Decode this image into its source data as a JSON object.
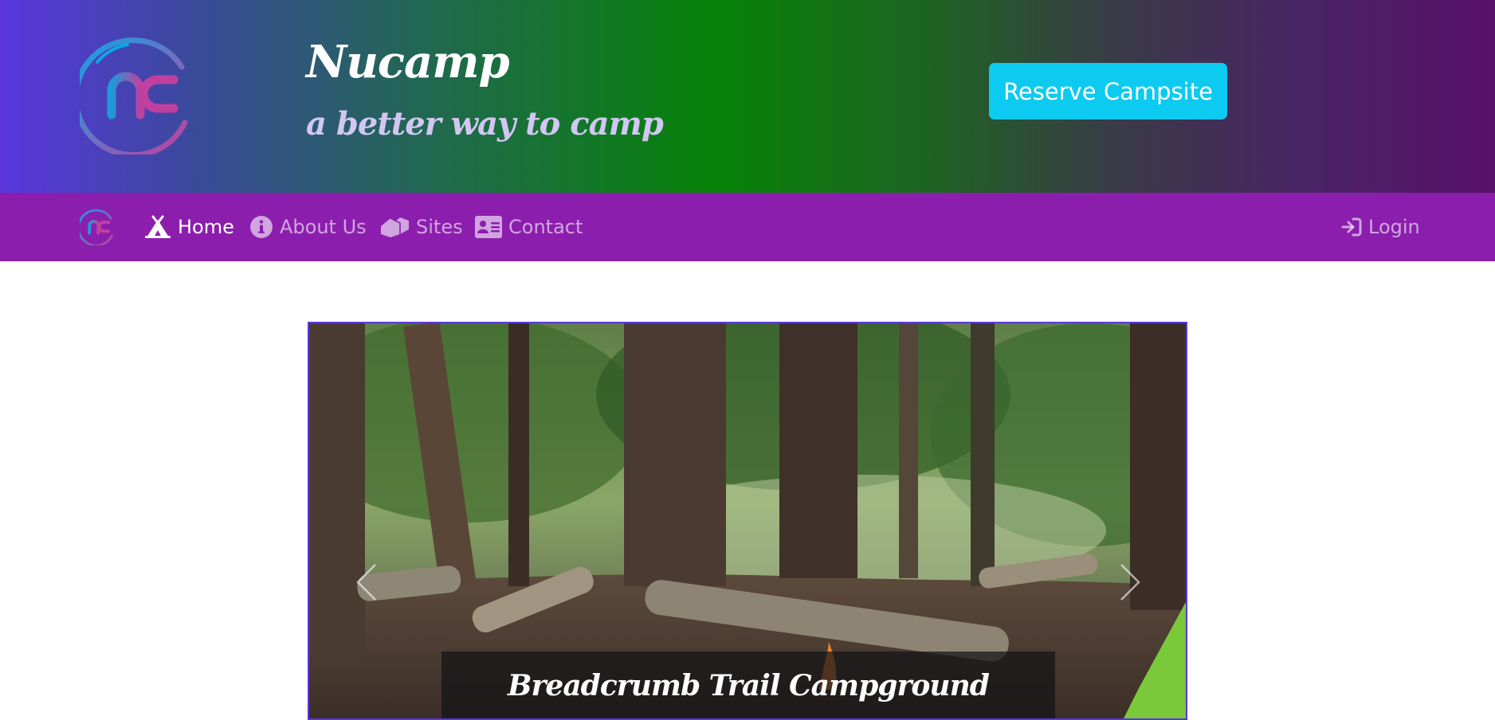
{
  "header": {
    "logo_icon": "nucamp-logo-icon",
    "title": "Nucamp",
    "tagline": "a better way to camp",
    "reserve_button": "Reserve Campsite"
  },
  "navbar": {
    "brand_icon": "nucamp-logo-icon",
    "items": [
      {
        "label": "Home",
        "icon": "campground-icon",
        "active": true
      },
      {
        "label": "About Us",
        "icon": "info-circle-icon",
        "active": false
      },
      {
        "label": "Sites",
        "icon": "house-icon",
        "active": false
      },
      {
        "label": "Contact",
        "icon": "address-card-icon",
        "active": false
      }
    ],
    "login": {
      "label": "Login",
      "icon": "sign-in-icon"
    }
  },
  "carousel": {
    "caption_title": "Breadcrumb Trail Campground",
    "prev_icon": "chevron-left-icon",
    "next_icon": "chevron-right-icon"
  },
  "colors": {
    "jumbotron_gradient": [
      "#5a36de",
      "#078207",
      "#581168"
    ],
    "navbar_bg": "#8c1eae",
    "reserve_button_bg": "#0dcaf0",
    "tagline": "#d2c7f3",
    "carousel_border": "#5a36de"
  }
}
